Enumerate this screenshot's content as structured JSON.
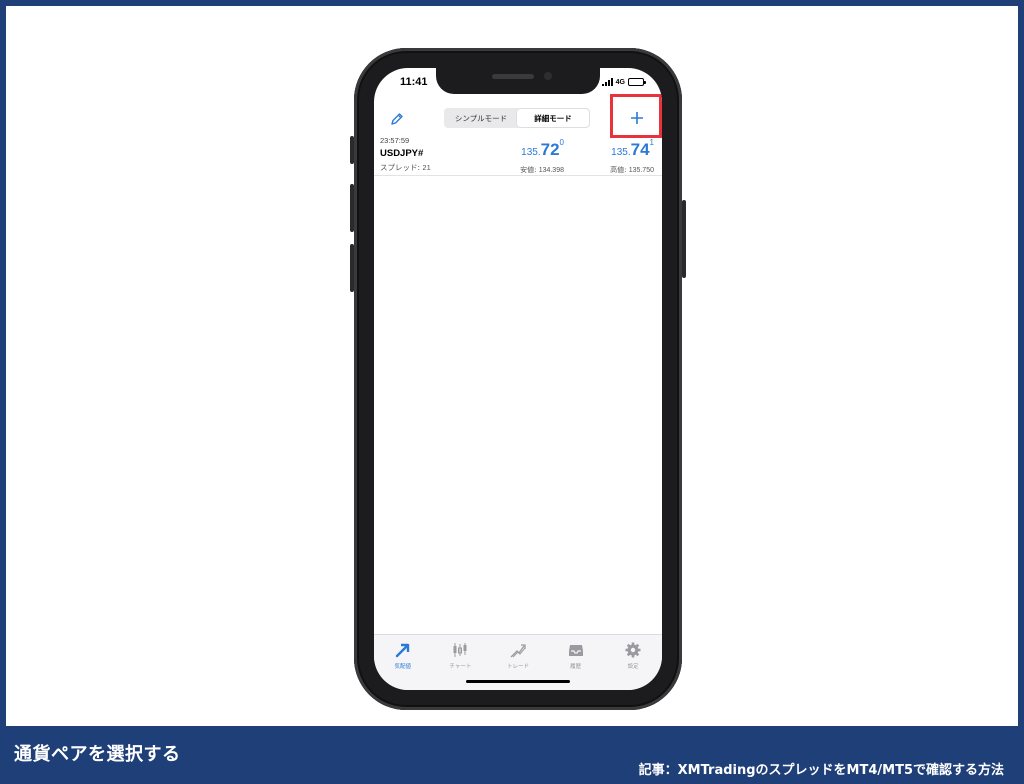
{
  "status_bar": {
    "time": "11:41",
    "network": "4G"
  },
  "toolbar": {
    "segments": [
      "シンプルモード",
      "詳細モード"
    ],
    "active_segment": "詳細モード",
    "add_symbol": "+"
  },
  "quote": {
    "time": "23:57:59",
    "symbol": "USDJPY#",
    "spread_label": "スプレッド:",
    "spread_value": "21",
    "bid": {
      "prefix": "135.",
      "big": "72",
      "sup": "0",
      "sub_label": "安値:",
      "sub_value": "134.398"
    },
    "ask": {
      "prefix": "135.",
      "big": "74",
      "sup": "1",
      "sub_label": "高値:",
      "sub_value": "135.750"
    }
  },
  "tabs": [
    {
      "label": "気配値",
      "icon": "quotes-icon",
      "active": true
    },
    {
      "label": "チャート",
      "icon": "candlestick-chart-icon",
      "active": false
    },
    {
      "label": "トレード",
      "icon": "trade-icon",
      "active": false
    },
    {
      "label": "履歴",
      "icon": "history-inbox-icon",
      "active": false
    },
    {
      "label": "設定",
      "icon": "gear-icon",
      "active": false
    }
  ],
  "colors": {
    "accent": "#2b7ad6",
    "highlight": "#e8323c",
    "frame": "#1f3f78"
  },
  "caption": {
    "title": "通貨ペアを選択する",
    "article": "記事：XMTradingのスプレッドをMT4/MT5で確認する方法"
  }
}
